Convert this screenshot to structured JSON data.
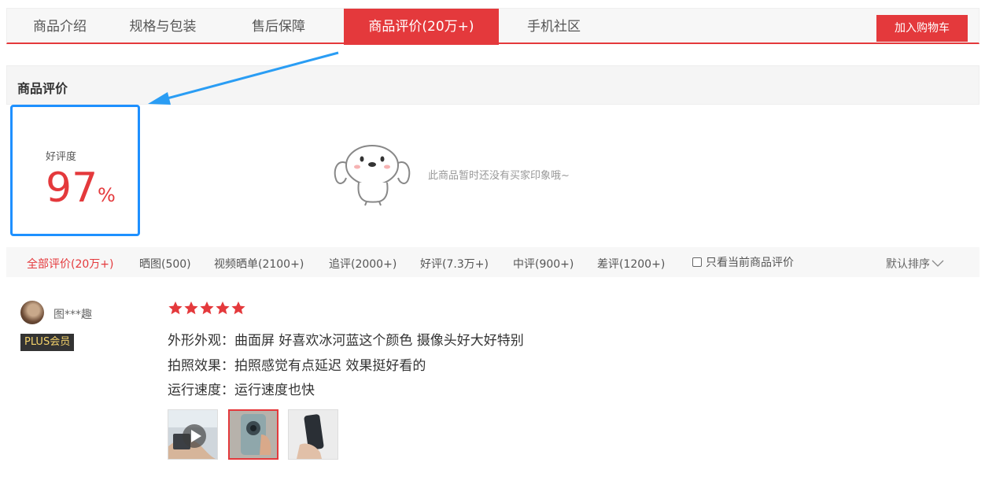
{
  "tabs": [
    {
      "label": "商品介绍",
      "active": false
    },
    {
      "label": "规格与包装",
      "active": false
    },
    {
      "label": "售后保障",
      "active": false
    },
    {
      "label": "商品评价(20万+)",
      "active": true
    },
    {
      "label": "手机社区",
      "active": false
    }
  ],
  "cart_button": "加入购物车",
  "section_title": "商品评价",
  "rating": {
    "label": "好评度",
    "value": "97",
    "unit": "%"
  },
  "empty_impression": "此商品暂时还没有买家印象哦~",
  "filters": [
    {
      "label": "全部评价(20万+)",
      "active": true
    },
    {
      "label": "晒图(500)",
      "active": false
    },
    {
      "label": "视频晒单(2100+)",
      "active": false
    },
    {
      "label": "追评(2000+)",
      "active": false
    },
    {
      "label": "好评(7.3万+)",
      "active": false
    },
    {
      "label": "中评(900+)",
      "active": false
    },
    {
      "label": "差评(1200+)",
      "active": false
    }
  ],
  "only_current": {
    "label": "只看当前商品评价",
    "checked": false
  },
  "sort_label": "默认排序",
  "review": {
    "username": "图***趣",
    "badge": "PLUS会员",
    "stars": 5,
    "lines": [
      "外形外观：曲面屏 好喜欢冰河蓝这个颜色 摄像头好大好特别",
      "拍照效果：拍照感觉有点延迟 效果挺好看的",
      "运行速度：运行速度也快"
    ],
    "thumbnails": [
      {
        "kind": "video",
        "selected": false
      },
      {
        "kind": "photo",
        "selected": true
      },
      {
        "kind": "photo",
        "selected": false
      }
    ]
  },
  "colors": {
    "accent": "#e4393c",
    "highlight_box": "#1e90ff",
    "arrow": "#2a9df4"
  }
}
